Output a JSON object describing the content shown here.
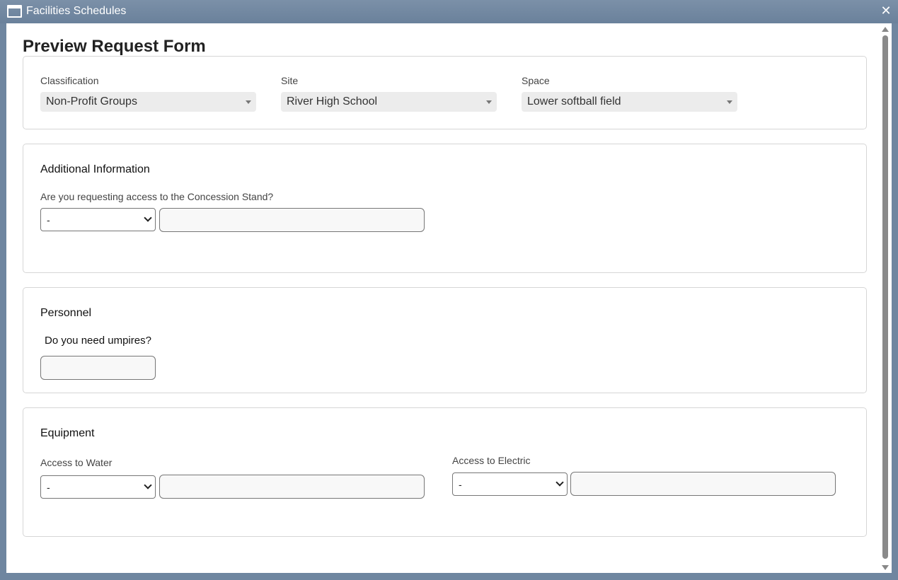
{
  "window": {
    "title": "Facilities Schedules",
    "close_glyph": "✕"
  },
  "form": {
    "title": "Preview Request Form"
  },
  "selection": {
    "classification_label": "Classification",
    "classification_value": "Non-Profit Groups",
    "site_label": "Site",
    "site_value": "River High School",
    "space_label": "Space",
    "space_value": "Lower softball field"
  },
  "additional_info": {
    "title": "Additional Information",
    "question": "Are you requesting access to the Concession Stand?",
    "select_value": "-",
    "text_value": ""
  },
  "personnel": {
    "title": "Personnel",
    "question": "Do you need umpires?",
    "text_value": ""
  },
  "equipment": {
    "title": "Equipment",
    "water_label": "Access to Water",
    "water_select_value": "-",
    "electric_label": "Access to Electric",
    "electric_select_value": "-"
  }
}
